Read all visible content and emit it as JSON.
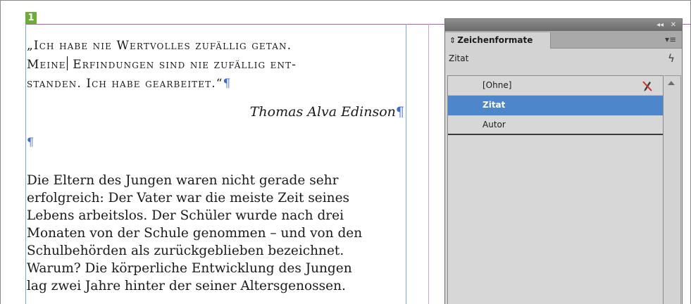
{
  "step_number": "1",
  "document": {
    "quote_lines": [
      "„Ich habe nie Wertvolles zufällig getan.",
      "Meine",
      "Erfindungen sind nie zufällig ent-",
      "standen. Ich habe gearbeitet.“"
    ],
    "pilcrow": "¶",
    "author": "Thomas Alva Edinson",
    "body_lines": [
      "Die Eltern des Jungen waren nicht gerade sehr",
      "erfolgreich: Der Vater war die meiste Zeit seines",
      "Lebens arbeitslos. Der Schüler wurde nach drei",
      "Monaten von der Schule genommen – und von den",
      "Schulbehörden als zurückgeblieben bezeichnet.",
      "Warum? Die körperliche Entwicklung des Jungen",
      "lag zwei Jahre hinter der seiner Altersgenossen."
    ]
  },
  "panel": {
    "collapse_glyph": "◂◂",
    "close_glyph": "✕",
    "tab_arrows": "⇕",
    "tab_title": "Zeichenformate",
    "menu_glyph": "▾≡",
    "current_style": "Zitat",
    "lightning_glyph": "ϟ",
    "styles": [
      {
        "label": "[Ohne]"
      },
      {
        "label": "Zitat"
      },
      {
        "label": "Autor"
      }
    ]
  }
}
